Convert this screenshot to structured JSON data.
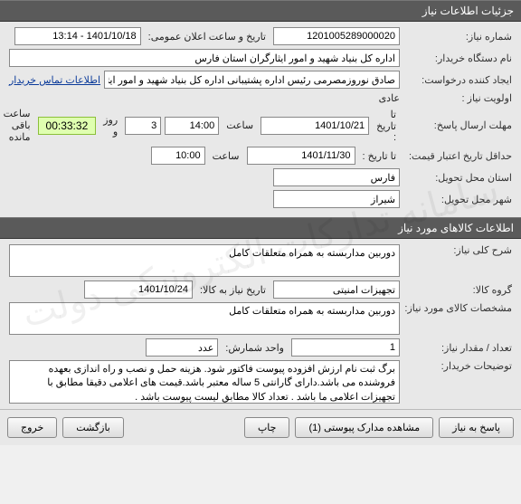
{
  "headers": {
    "need_info": "جزئیات اطلاعات نیاز",
    "items_info": "اطلاعات کالاهای مورد نیاز"
  },
  "watermark": "سامانه تدارکات الکترونیکی دولت",
  "labels": {
    "need_no": "شماره نیاز:",
    "announce_dt": "تاریخ و ساعت اعلان عمومی:",
    "buyer_org": "نام دستگاه خریدار:",
    "requester": "ایجاد کننده درخواست:",
    "priority": "اولویت نیاز :",
    "reply_deadline": "مهلت ارسال پاسخ:",
    "until_date": "تا تاریخ :",
    "time": "ساعت",
    "days_and": "روز و",
    "time_remaining": "ساعت باقی مانده",
    "price_valid_min": "حداقل تاریخ اعتبار قیمت:",
    "delivery_province": "استان محل تحویل:",
    "delivery_city": "شهر محل تحویل:",
    "need_desc": "شرح کلی نیاز:",
    "item_group": "گروه کالا:",
    "need_by_date": "تاریخ نیاز به کالا:",
    "item_spec": "مشخصات کالای مورد نیاز:",
    "qty": "تعداد / مقدار نیاز:",
    "unit": "واحد شمارش:",
    "buyer_notes": "توضیحات خریدار:"
  },
  "values": {
    "need_no": "1201005289000020",
    "announce_dt": "1401/10/18 - 13:14",
    "buyer_org": "اداره کل بنیاد شهید و امور ایثارگران استان فارس",
    "requester": "صادق نوروزمصرمی رئیس اداره پشتیبانی اداره کل بنیاد شهید و امور ایثارگران اس",
    "priority": "عادی",
    "reply_until_date": "1401/10/21",
    "reply_until_time": "14:00",
    "days_remaining": "3",
    "timer": "00:33:32",
    "price_valid_date": "1401/11/30",
    "price_valid_time": "10:00",
    "province": "فارس",
    "city": "شیراز",
    "need_desc": "دوربین مداربسته به همراه متعلقات کامل",
    "item_group": "تجهیزات امنیتی",
    "need_by_date": "1401/10/24",
    "item_spec": "دوربین مداربسته به همراه متعلقات کامل",
    "qty": "1",
    "unit": "عدد",
    "buyer_notes": "برگ ثبت نام ارزش افزوده پیوست فاکتور شود. هزینه حمل و نصب و راه اندازی بعهده فروشنده می باشد.دارای گارانتی 5 ساله معتبر باشد.قیمت های اعلامی دقیقا مطابق با تجهیزات اعلامی ما باشد . تعداد کالا مطابق لیست پیوست باشد ."
  },
  "links": {
    "buyer_contact": "اطلاعات تماس خریدار"
  },
  "buttons": {
    "reply": "پاسخ به نیاز",
    "attachments": "مشاهده مدارک پیوستی (1)",
    "print": "چاپ",
    "back": "بازگشت",
    "exit": "خروج"
  }
}
